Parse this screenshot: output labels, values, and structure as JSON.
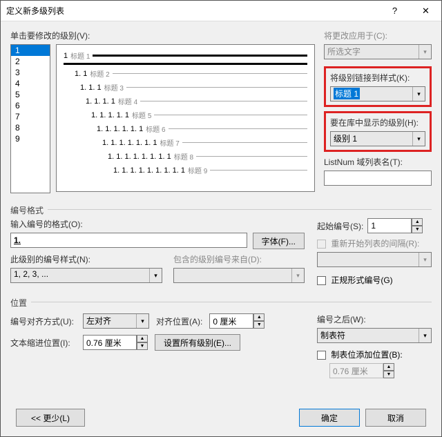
{
  "title": "定义新多级列表",
  "titlebar": {
    "close": "✕",
    "help": "?"
  },
  "section_levels_label": "单击要修改的级别(V):",
  "levels": [
    "1",
    "2",
    "3",
    "4",
    "5",
    "6",
    "7",
    "8",
    "9"
  ],
  "selected_level": "1",
  "preview": [
    {
      "num": "1",
      "head": "标题 1",
      "thick": true
    },
    {
      "num": " ",
      "head": "",
      "thick": true,
      "extra": true
    },
    {
      "num": "1. 1",
      "head": "标题 2"
    },
    {
      "num": "1. 1. 1",
      "head": "标题 3"
    },
    {
      "num": "1. 1. 1. 1",
      "head": "标题 4"
    },
    {
      "num": "1. 1. 1. 1. 1",
      "head": "标题 5"
    },
    {
      "num": "1. 1. 1. 1. 1. 1",
      "head": "标题 6"
    },
    {
      "num": "1. 1. 1. 1. 1. 1. 1",
      "head": "标题 7"
    },
    {
      "num": "1. 1. 1. 1. 1. 1. 1. 1",
      "head": "标题 8"
    },
    {
      "num": "1. 1. 1. 1. 1. 1. 1. 1. 1",
      "head": "标题 9"
    }
  ],
  "apply_to_label": "将更改应用于(C):",
  "apply_to_value": "所选文字",
  "link_style_label": "将级别链接到样式(K):",
  "link_style_value": "标题 1",
  "show_in_gallery_label": "要在库中显示的级别(H):",
  "show_in_gallery_value": "级别 1",
  "listnum_label": "ListNum 域列表名(T):",
  "listnum_value": "",
  "numfmt_section": "编号格式",
  "numfmt_input_label": "输入编号的格式(O):",
  "numfmt_input_value": "1.",
  "font_btn": "字体(F)...",
  "numstyle_label": "此级别的编号样式(N):",
  "numstyle_value": "1, 2, 3, ...",
  "include_label": "包含的级别编号来自(D):",
  "include_value": "",
  "start_at_label": "起始编号(S):",
  "start_at_value": "1",
  "restart_label": "重新开始列表的间隔(R):",
  "legal_label": "正规形式编号(G)",
  "pos_section": "位置",
  "align_label": "编号对齐方式(U):",
  "align_value": "左对齐",
  "align_at_label": "对齐位置(A):",
  "align_at_value": "0 厘米",
  "indent_label": "文本缩进位置(I):",
  "indent_value": "0.76 厘米",
  "set_all_btn": "设置所有级别(E)...",
  "follow_label": "编号之后(W):",
  "follow_value": "制表符",
  "tab_stop_label": "制表位添加位置(B):",
  "tab_stop_value": "0.76 厘米",
  "less_btn": "<< 更少(L)",
  "ok_btn": "确定",
  "cancel_btn": "取消"
}
